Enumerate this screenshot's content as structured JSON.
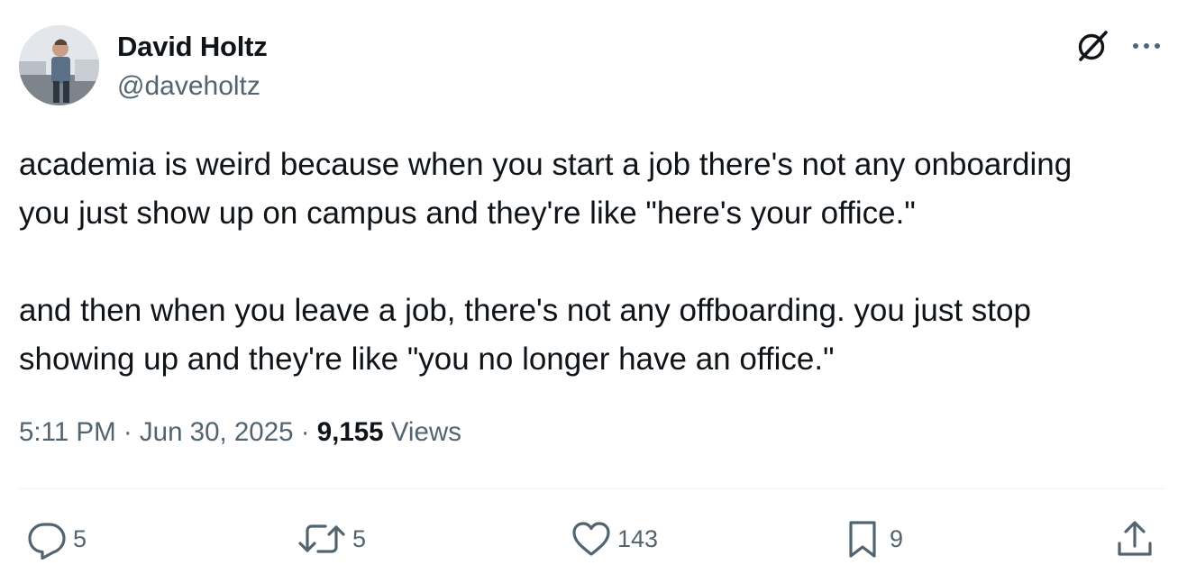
{
  "author": {
    "display_name": "David Holtz",
    "handle": "@daveholtz"
  },
  "tweet": {
    "text": "academia is weird because when you start a job there's not any onboarding\nyou just show up on campus and they're like \"here's your office.\"\n\nand then when you leave a job, there's not any offboarding. you just stop\nshowing up and they're like \"you no longer have an office.\"",
    "time": "5:11 PM",
    "separator": "·",
    "date": "Jun 30, 2025",
    "views_count": "9,155",
    "views_label": "Views"
  },
  "actions": {
    "replies": "5",
    "reposts": "5",
    "likes": "143",
    "bookmarks": "9"
  },
  "icons": {
    "top_right": [
      "grok-icon",
      "more-icon"
    ],
    "actions": [
      "reply-icon",
      "retweet-icon",
      "like-icon",
      "bookmark-icon",
      "share-icon"
    ]
  },
  "colors": {
    "text_primary": "#0f1419",
    "text_secondary": "#536471",
    "divider": "#eff3f4"
  }
}
